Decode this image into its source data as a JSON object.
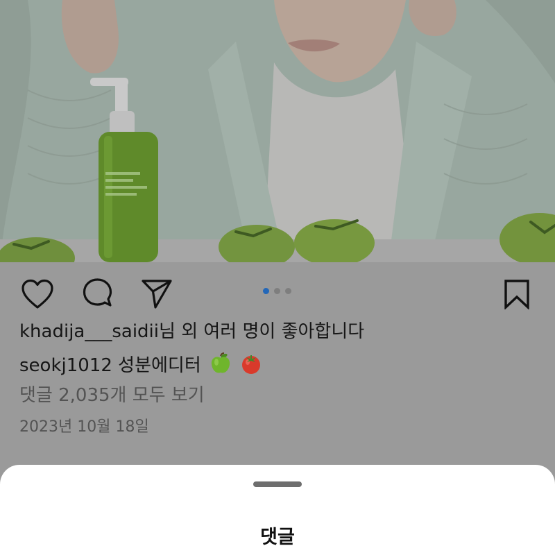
{
  "post": {
    "liked_by_text": "khadija___saidii님 외 여러 명이 좋아합니다",
    "caption_username": "seokj1012",
    "caption_text": "성분에디터",
    "caption_emojis": [
      "green-apple",
      "tomato"
    ],
    "view_comments_text": "댓글 2,035개 모두 보기",
    "date_text": "2023년 10월 18일"
  },
  "carousel": {
    "count": 3,
    "active_index": 0
  },
  "icons": {
    "like": "heart-icon",
    "comment": "speech-bubble-icon",
    "share": "paper-plane-icon",
    "save": "bookmark-icon"
  },
  "bottom_sheet": {
    "title": "댓글"
  },
  "colors": {
    "dim_overlay": "#9a9a9a",
    "active_dot": "#2367b8",
    "sheet_background": "#ffffff"
  }
}
